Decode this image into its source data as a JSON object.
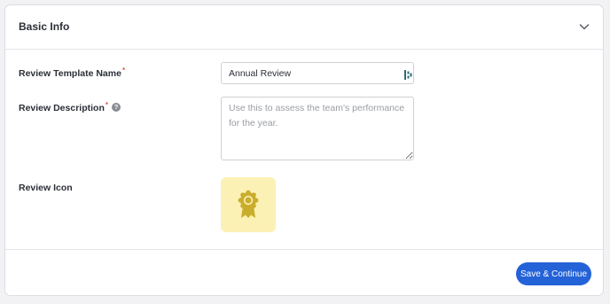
{
  "section": {
    "title": "Basic Info"
  },
  "form": {
    "template_name": {
      "label": "Review Template Name",
      "required_marker": "*",
      "value": "Annual Review"
    },
    "description": {
      "label": "Review Description",
      "required_marker": "*",
      "help_glyph": "?",
      "placeholder": "Use this to assess the team's performance for the year.",
      "value": ""
    },
    "icon": {
      "label": "Review Icon",
      "icon_name": "award-ribbon-icon",
      "background_color": "#fbf1b4",
      "icon_color": "#c9ad2c"
    }
  },
  "footer": {
    "primary_label": "Save & Continue",
    "primary_color": "#2462d7"
  },
  "colors": {
    "required_marker": "#e05a47",
    "page_background": "#f2f2f4"
  }
}
